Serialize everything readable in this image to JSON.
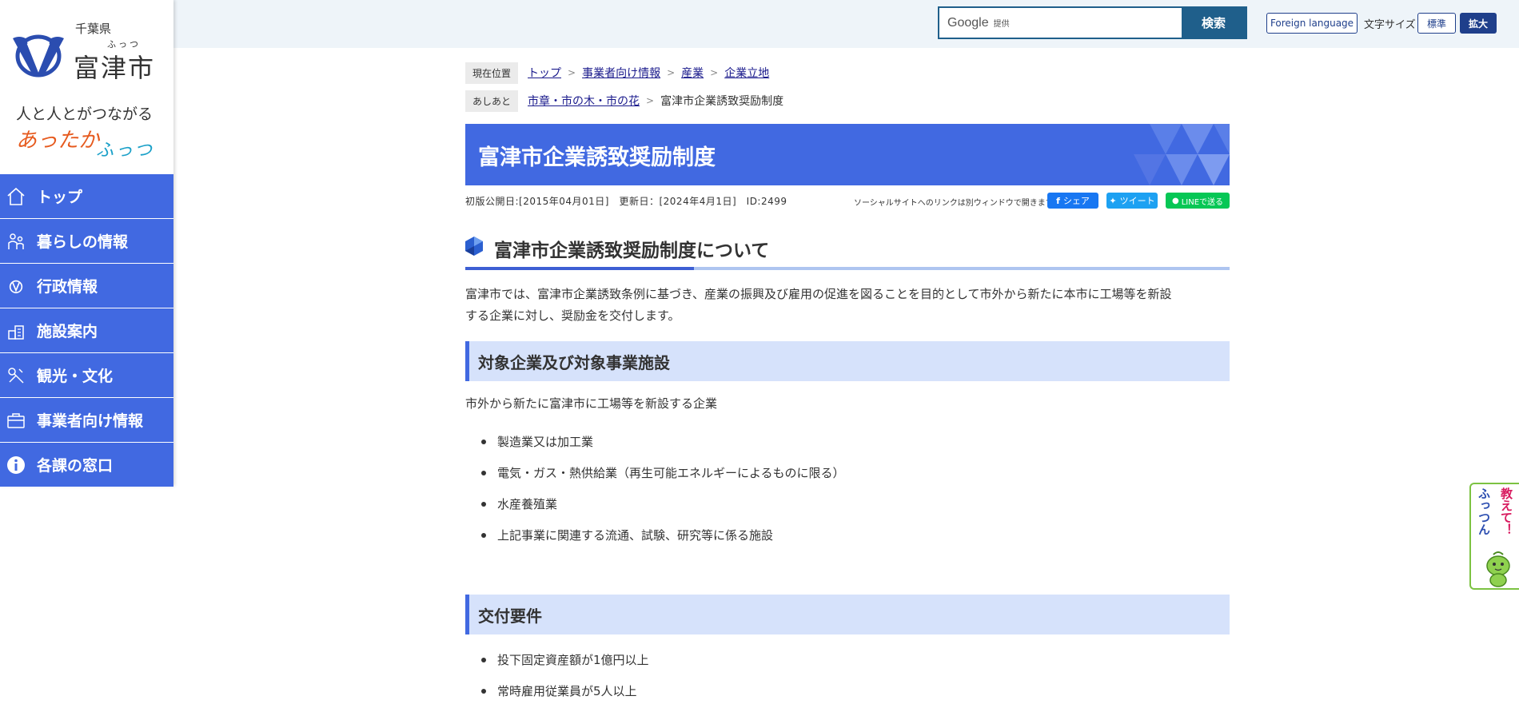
{
  "header": {
    "search_brand": "Google",
    "search_brand_sub": "提供",
    "search_button": "検索",
    "foreign_language": "Foreign language",
    "text_size_label": "文字サイズ",
    "size_standard": "標準",
    "size_large": "拡大"
  },
  "sidebar": {
    "prefecture": "千葉県",
    "city_ruby": "ふっつ",
    "city_name": "富津市",
    "tagline": "人と人とがつながる",
    "slogan_a": "あったか",
    "slogan_b": "ふっつ",
    "items": [
      {
        "label": "トップ",
        "icon": "home-icon"
      },
      {
        "label": "暮らしの情報",
        "icon": "family-icon"
      },
      {
        "label": "行政情報",
        "icon": "city-emblem-icon"
      },
      {
        "label": "施設案内",
        "icon": "building-icon"
      },
      {
        "label": "観光・文化",
        "icon": "tourism-icon"
      },
      {
        "label": "事業者向け情報",
        "icon": "briefcase-icon"
      },
      {
        "label": "各課の窓口",
        "icon": "info-icon"
      }
    ]
  },
  "breadcrumb": {
    "current_label": "現在位置",
    "path": [
      "トップ",
      "事業者向け情報",
      "産業",
      "企業立地"
    ],
    "history_label": "あしあと",
    "history_link": "市章・市の木・市の花",
    "history_current": "富津市企業誘致奨励制度"
  },
  "page": {
    "title": "富津市企業誘致奨励制度",
    "meta": "初版公開日:[2015年04月01日]　更新日：[2024年4月1日]　ID:2499",
    "social_note": "ソーシャルサイトへのリンクは別ウィンドウで開きます",
    "share_facebook": "シェア",
    "share_twitter": "ツイート",
    "share_line": "LINEで送る",
    "h2": "富津市企業誘致奨励制度について",
    "intro_line1": "富津市では、富津市企業誘致条例に基づき、産業の振興及び雇用の促進を図ることを目的として市外から新たに本市に工場等を新設",
    "intro_line2": "する企業に対し、奨励金を交付します。",
    "section1_title": "対象企業及び対象事業施設",
    "section1_lead": "市外から新たに富津市に工場等を新設する企業",
    "section1_items": [
      "製造業又は加工業",
      "電気・ガス・熱供給業（再生可能エネルギーによるものに限る）",
      "水産養殖業",
      "上記事業に関連する流通、試験、研究等に係る施設"
    ],
    "section2_title": "交付要件",
    "section2_items": [
      "投下固定資産額が1億円以上",
      "常時雇用従業員が5人以上"
    ]
  },
  "helper": {
    "text1": "ふっつん",
    "text2": "教えて！"
  },
  "colors": {
    "nav_blue": "#4169e1",
    "search_navy": "#1f5f8b",
    "section_bg": "#d6e2fb",
    "slogan_orange": "#e65a1e",
    "slogan_teal": "#1aa0c8"
  }
}
